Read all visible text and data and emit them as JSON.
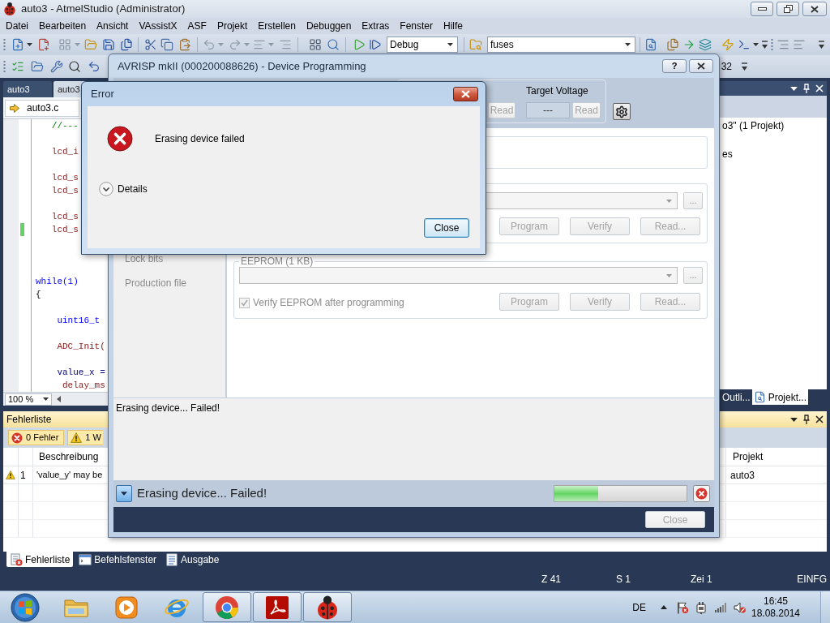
{
  "window": {
    "title": "auto3 - AtmelStudio (Administrator)"
  },
  "menu": [
    "Datei",
    "Bearbeiten",
    "Ansicht",
    "VAssistX",
    "ASF",
    "Projekt",
    "Erstellen",
    "Debuggen",
    "Extras",
    "Fenster",
    "Hilfe"
  ],
  "toolbar": {
    "configuration": "Debug",
    "find_combo": "fuses",
    "row_2_label": "32"
  },
  "document_tabs": [
    {
      "label": "auto3",
      "selected": false
    },
    {
      "label": "auto3",
      "selected": true
    }
  ],
  "editor": {
    "file": "auto3.c",
    "lines": [
      {
        "kind": "comment",
        "text": "   //---",
        "changed": false
      },
      {
        "kind": "blank"
      },
      {
        "kind": "function",
        "text": "   lcd_i",
        "changed": false
      },
      {
        "kind": "blank"
      },
      {
        "kind": "function",
        "text": "   lcd_s",
        "changed": false
      },
      {
        "kind": "function",
        "text": "   lcd_s",
        "changed": false
      },
      {
        "kind": "blank"
      },
      {
        "kind": "function",
        "text": "   lcd_s",
        "changed": false
      },
      {
        "kind": "function",
        "text": "   lcd_s",
        "changed": true
      },
      {
        "kind": "blank"
      },
      {
        "kind": "blank"
      },
      {
        "kind": "blank"
      },
      {
        "kind": "keyword",
        "text": "while(1)",
        "changed": false
      },
      {
        "kind": "plain",
        "text": "{",
        "changed": false
      },
      {
        "kind": "blank"
      },
      {
        "kind": "type",
        "text": "    uint16_t",
        "changed": false
      },
      {
        "kind": "blank"
      },
      {
        "kind": "function",
        "text": "    ADC_Init(",
        "changed": false
      },
      {
        "kind": "blank"
      },
      {
        "kind": "variable",
        "text": "    value_x =",
        "changed": false
      },
      {
        "kind": "function",
        "text": "     delay_ms",
        "changed": false
      }
    ],
    "zoom": "100 %"
  },
  "solution_explorer": {
    "items": [
      "o3\" (1 Projekt)",
      "es"
    ],
    "tabs": [
      {
        "label": "Outli...",
        "selected": false
      },
      {
        "label": "Projekt...",
        "selected": true
      }
    ]
  },
  "error_list": {
    "title": "Fehlerliste",
    "filters": [
      {
        "kind": "error",
        "label": "0 Fehler",
        "on": true
      },
      {
        "kind": "warning",
        "label": "1 W",
        "on": true
      }
    ],
    "columns": [
      "Beschreibung",
      "Projekt"
    ],
    "rows": [
      {
        "kind": "warning",
        "number": "1",
        "description": "'value_y' may be",
        "project": "auto3"
      }
    ]
  },
  "bottom_tabs": [
    {
      "label": "Fehlerliste",
      "selected": true
    },
    {
      "label": "Befehlsfenster",
      "selected": false
    },
    {
      "label": "Ausgabe",
      "selected": false
    }
  ],
  "status_bar": [
    "Z 41",
    "S 1",
    "Zei 1",
    "EINFG"
  ],
  "device_programming": {
    "title": "AVRISP mkII (000200088626) - Device Programming",
    "help_button": "?",
    "signature_read_button": {
      "label": "Read",
      "disabled": true
    },
    "target_voltage": {
      "label": "Target Voltage",
      "value": "---",
      "read_button": {
        "label": "Read",
        "disabled": true
      }
    },
    "nav": [
      {
        "label": "Lock bits",
        "disabled": true
      },
      {
        "label": "Production file",
        "disabled": true
      }
    ],
    "memories": [
      {
        "browse_button": "...",
        "buttons": [
          {
            "label": "Program",
            "disabled": true
          },
          {
            "label": "Verify",
            "disabled": true
          },
          {
            "label": "Read...",
            "disabled": true
          }
        ]
      },
      {
        "title": "EEPROM (1 KB)",
        "browse_button": "...",
        "verify_option": {
          "label": "Verify EEPROM after programming",
          "checked": true,
          "disabled": true
        },
        "buttons": [
          {
            "label": "Program",
            "disabled": true
          },
          {
            "label": "Verify",
            "disabled": true
          },
          {
            "label": "Read...",
            "disabled": true
          }
        ]
      }
    ],
    "log": [
      "Erasing device... Failed!"
    ],
    "status": {
      "message": "Erasing device... Failed!",
      "progress": {
        "level": 0.33
      }
    },
    "close_button": {
      "label": "Close",
      "disabled": true
    }
  },
  "error_dialog": {
    "title": "Error",
    "message": "Erasing device failed",
    "details": {
      "label": "Details",
      "expanded": false
    },
    "close_button": "Close"
  },
  "taskbar": {
    "apps": [
      {
        "kind": "folder",
        "running": false
      },
      {
        "kind": "media",
        "running": false
      },
      {
        "kind": "web",
        "running": false
      },
      {
        "kind": "browser",
        "running": true
      },
      {
        "kind": "pdf",
        "running": true
      },
      {
        "kind": "ladybug",
        "running": true
      }
    ],
    "language": "DE",
    "time": "16:45",
    "date": "18.08.2014"
  }
}
